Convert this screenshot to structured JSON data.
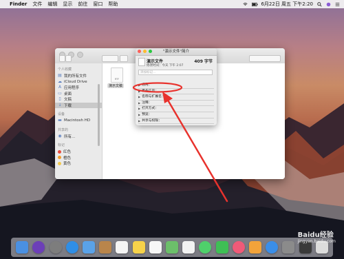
{
  "menubar": {
    "app_name": "Finder",
    "items": [
      "文件",
      "编辑",
      "显示",
      "前往",
      "窗口",
      "帮助"
    ],
    "clock": "6月22日 周五 下午2:20"
  },
  "finder": {
    "sidebar": {
      "favorites_header": "个人收藏",
      "favorites": [
        {
          "label": "我的所有文件",
          "icon": "all-files-icon"
        },
        {
          "label": "iCloud Drive",
          "icon": "cloud-icon"
        },
        {
          "label": "应用程序",
          "icon": "applications-icon"
        },
        {
          "label": "桌面",
          "icon": "desktop-icon"
        },
        {
          "label": "文稿",
          "icon": "documents-icon"
        },
        {
          "label": "下载",
          "icon": "download-icon"
        }
      ],
      "devices_header": "设备",
      "devices": [
        {
          "label": "Macintosh HD",
          "icon": "disk-icon"
        }
      ],
      "shared_header": "共享的",
      "shared": [
        {
          "label": "所有...",
          "icon": "network-icon"
        }
      ],
      "tags_header": "标记",
      "tags": [
        {
          "label": "红色",
          "color": "#e84a3c"
        },
        {
          "label": "橙色",
          "color": "#f39c2b"
        },
        {
          "label": "黄色",
          "color": "#f2c94c"
        }
      ]
    },
    "file": {
      "name": "演示文稿",
      "ext": "RTF"
    }
  },
  "info_window": {
    "title": "\"演示文件\"简介",
    "file_name": "演示文件",
    "file_size": "409 字节",
    "modified": "修改时间：今天 下午 2:07",
    "tags_placeholder": "添加标记...",
    "sections": [
      "通用：",
      "更多信息：",
      "名称与扩展名：",
      "注释：",
      "打开方式：",
      "预览：",
      "共享与权限："
    ]
  },
  "dock": {
    "icons": [
      {
        "name": "finder-icon",
        "color": "#4a90e2"
      },
      {
        "name": "siri-icon",
        "color": "#6c3fb8"
      },
      {
        "name": "launchpad-icon",
        "color": "#7d7d7d"
      },
      {
        "name": "safari-icon",
        "color": "#2f8ee6"
      },
      {
        "name": "mail-icon",
        "color": "#5aa2e8"
      },
      {
        "name": "contacts-icon",
        "color": "#b9854b"
      },
      {
        "name": "calendar-icon",
        "color": "#f4f4f4"
      },
      {
        "name": "notes-icon",
        "color": "#f6d24a"
      },
      {
        "name": "reminders-icon",
        "color": "#f7f7f7"
      },
      {
        "name": "maps-icon",
        "color": "#6cbf6a"
      },
      {
        "name": "photos-icon",
        "color": "#f2f2f2"
      },
      {
        "name": "messages-icon",
        "color": "#4fd06b"
      },
      {
        "name": "facetime-icon",
        "color": "#3fbf55"
      },
      {
        "name": "music-icon",
        "color": "#f05a78"
      },
      {
        "name": "ibooks-icon",
        "color": "#f2a33a"
      },
      {
        "name": "appstore-icon",
        "color": "#3a8ee8"
      },
      {
        "name": "preferences-icon",
        "color": "#8b8b8b"
      },
      {
        "name": "photo-booth-icon",
        "color": "#3a3a3a"
      },
      {
        "name": "trash-icon",
        "color": "#dcdcdc"
      }
    ]
  },
  "watermark": {
    "text": "Baidu经验",
    "sub": "jingyan.baidu.com"
  }
}
